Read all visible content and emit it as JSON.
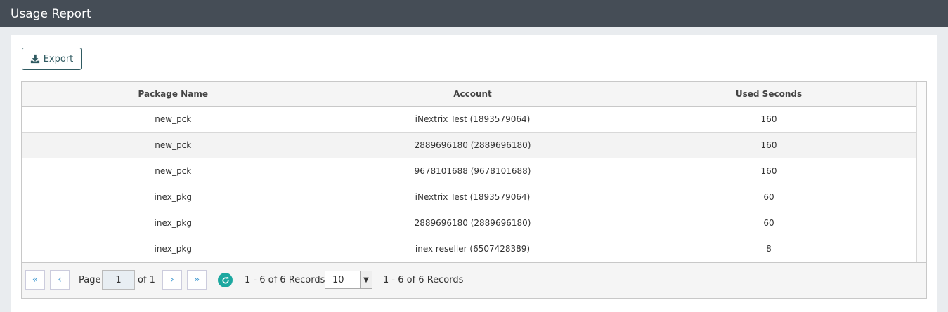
{
  "header": {
    "title": "Usage Report"
  },
  "toolbar": {
    "export_label": "Export"
  },
  "table": {
    "columns": [
      "Package Name",
      "Account",
      "Used Seconds"
    ],
    "rows": [
      [
        "new_pck",
        "iNextrix Test (1893579064)",
        "160"
      ],
      [
        "new_pck",
        "2889696180 (2889696180)",
        "160"
      ],
      [
        "new_pck",
        "9678101688 (9678101688)",
        "160"
      ],
      [
        "inex_pkg",
        "iNextrix Test (1893579064)",
        "60"
      ],
      [
        "inex_pkg",
        "2889696180 (2889696180)",
        "60"
      ],
      [
        "inex_pkg",
        "inex reseller (6507428389)",
        "8"
      ]
    ]
  },
  "pager": {
    "first_icon": "«",
    "prev_icon": "‹",
    "next_icon": "›",
    "last_icon": "»",
    "page_label": "Page",
    "page_value": "1",
    "of_label": "of 1",
    "records_left": "1 - 6 of 6 Records",
    "page_size": "10",
    "records_right": "1 - 6 of 6 Records"
  },
  "colors": {
    "titlebar": "#454d56",
    "accent": "#1ca8a0",
    "button_border": "#2f5a61"
  },
  "icons": {
    "export": "download-icon",
    "refresh": "refresh-icon",
    "dropdown": "chevron-down-icon"
  }
}
